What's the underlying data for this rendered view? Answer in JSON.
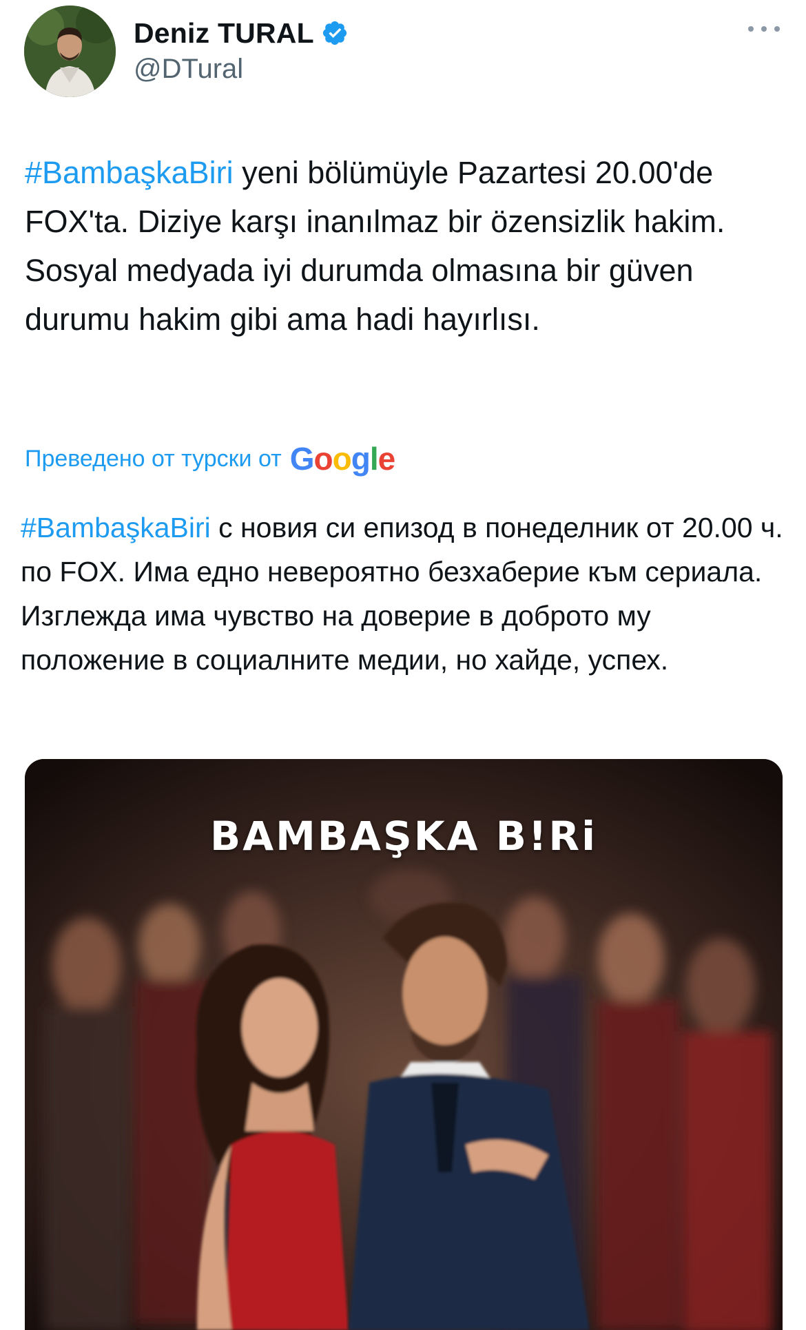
{
  "author": {
    "display_name": "Deniz TURAL",
    "handle": "@DTural",
    "verified": true,
    "verified_icon": "verified-badge-icon",
    "avatar_icon": "avatar-photo"
  },
  "header": {
    "more_icon": "more-options-icon"
  },
  "tweet": {
    "hashtag": "#BambaşkaBiri",
    "text": " yeni bölümüyle Pazartesi 20.00'de FOX'ta. Diziye karşı inanılmaz bir özensizlik hakim. Sosyal medyada iyi durumda olmasına bir güven durumu hakim gibi ama hadi hayırlısı."
  },
  "translation": {
    "label": "Преведено от турски от",
    "provider": "Google",
    "hashtag": "#BambaşkaBiri",
    "text": " с новия си епизод в понеделник от 20.00 ч. по FOX. Има едно невероятно безхаберие към сериала. Изглежда има чувство на доверие в доброто му положение в социалните медии, но хайде, успех."
  },
  "media": {
    "poster_title": "BAMBAŞKA B!Ri"
  },
  "colors": {
    "link": "#1d9bf0",
    "text": "#0f1419",
    "secondary": "#536471",
    "google_blue": "#4285f4",
    "google_red": "#ea4335",
    "google_yellow": "#fbbc05",
    "google_green": "#34a853"
  }
}
